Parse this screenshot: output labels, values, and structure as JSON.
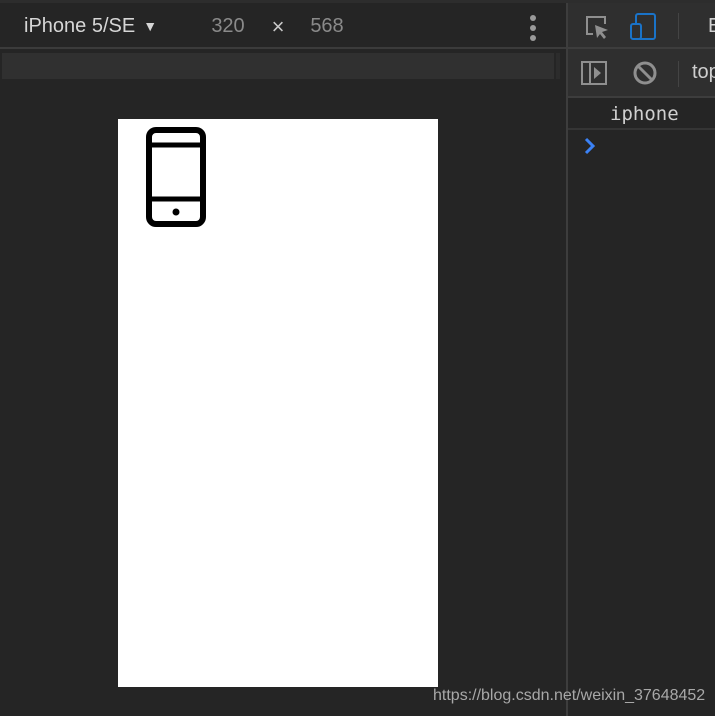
{
  "emulation_toolbar": {
    "device_name": "iPhone 5/SE",
    "device_dropdown_icon": "caret-down-icon",
    "width": "320",
    "height": "568",
    "times_symbol": "×",
    "more_options_icon": "more-vertical-icon"
  },
  "viewport": {
    "content_icon": "smartphone-icon",
    "background_color": "#ffffff"
  },
  "devtools": {
    "toolbar": {
      "inspect_icon": "inspect-element-icon",
      "device_toggle_icon": "device-toolbar-icon",
      "device_toggle_active_color": "#1a73c8",
      "next_tab_partial": "E"
    },
    "console_toolbar": {
      "sidebar_icon": "show-console-sidebar-icon",
      "clear_icon": "clear-console-icon",
      "context_partial": "top"
    },
    "console": {
      "messages": [
        {
          "text": "iphone"
        }
      ],
      "prompt_icon": "chevron-right-icon",
      "prompt_color": "#3b82f6"
    }
  },
  "watermark": "https://blog.csdn.net/weixin_37648452"
}
